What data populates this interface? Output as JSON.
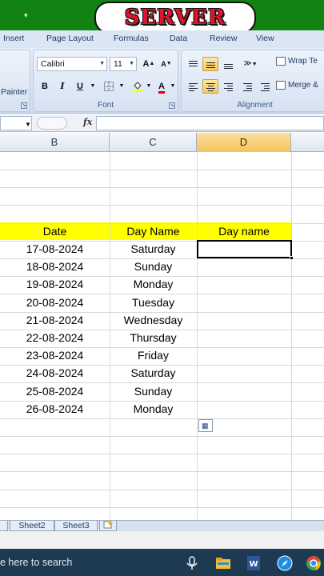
{
  "watermark": {
    "text": "SERVER"
  },
  "ribbon_tabs": [
    "Insert",
    "Page Layout",
    "Formulas",
    "Data",
    "Review",
    "View"
  ],
  "clipboard": {
    "painter_label": "Painter"
  },
  "font_group": {
    "font_name": "Calibri",
    "font_size": "11",
    "grow_glyph": "A",
    "shrink_glyph": "A",
    "bold_glyph": "B",
    "italic_glyph": "I",
    "underline_glyph": "U",
    "font_color_glyph": "A",
    "label": "Font",
    "fill_color": "#ffff00",
    "font_color": "#e00000"
  },
  "alignment_group": {
    "wrap_text_label": "Wrap Te",
    "merge_label": "Merge &",
    "label": "Alignment"
  },
  "formula_bar": {
    "fx_label": "fx",
    "value": ""
  },
  "columns": {
    "b": "B",
    "c": "C",
    "d": "D"
  },
  "table": {
    "header_color": "#ffff00",
    "headers": [
      "Date",
      "Day Name",
      "Day name"
    ],
    "rows": [
      [
        "17-08-2024",
        "Saturday",
        ""
      ],
      [
        "18-08-2024",
        "Sunday",
        ""
      ],
      [
        "19-08-2024",
        "Monday",
        ""
      ],
      [
        "20-08-2024",
        "Tuesday",
        ""
      ],
      [
        "21-08-2024",
        "Wednesday",
        ""
      ],
      [
        "22-08-2024",
        "Thursday",
        ""
      ],
      [
        "23-08-2024",
        "Friday",
        ""
      ],
      [
        "24-08-2024",
        "Saturday",
        ""
      ],
      [
        "25-08-2024",
        "Sunday",
        ""
      ],
      [
        "26-08-2024",
        "Monday",
        ""
      ]
    ]
  },
  "sheet_tabs": [
    "Sheet2",
    "Sheet3"
  ],
  "taskbar": {
    "search_text": "e here to search"
  }
}
